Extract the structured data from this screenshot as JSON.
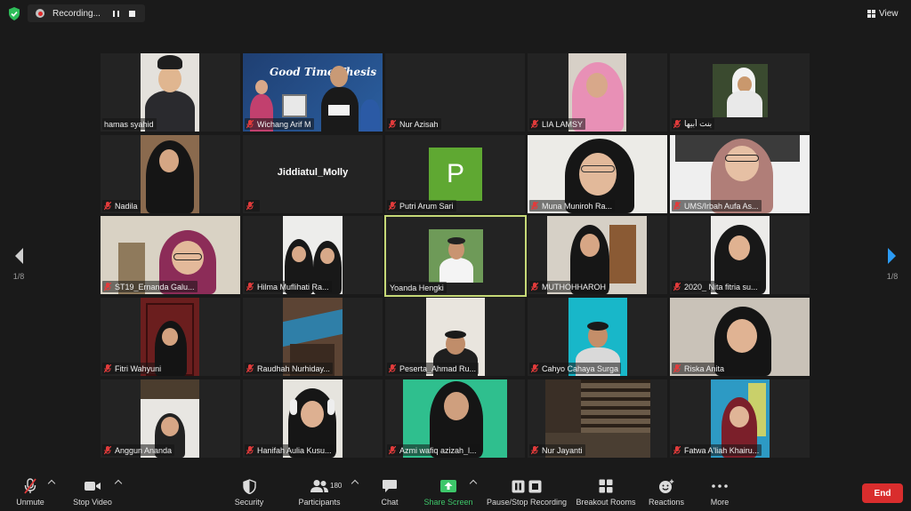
{
  "recording": {
    "label": "Recording..."
  },
  "view": {
    "label": "View"
  },
  "pager": {
    "left_label": "1/8",
    "right_label": "1/8"
  },
  "colors": {
    "active_speaker_border": "#c6d977",
    "end_button": "#d92d2d",
    "share_green": "#3dc76a",
    "avatar_green": "#5fa832"
  },
  "participants": [
    {
      "name": "hamas syahid",
      "muted": false
    },
    {
      "name": "Wichang Arif M",
      "muted": true
    },
    {
      "name": "Nur Azisah",
      "muted": true
    },
    {
      "name": "LIA LAMSY",
      "muted": true
    },
    {
      "name": "بنت أبيها",
      "muted": true
    },
    {
      "name": "Nadila",
      "muted": true
    },
    {
      "name": "Jiddiatul_Molly",
      "muted": true,
      "camera_off": true
    },
    {
      "name": "Putri Arum Sari",
      "muted": true,
      "avatar_letter": "P"
    },
    {
      "name": "Muna Muniroh Ra...",
      "muted": true
    },
    {
      "name": "UMS/Irbah Aufa As...",
      "muted": true
    },
    {
      "name": "ST19_Ernanda Galu...",
      "muted": true
    },
    {
      "name": "Hilma Muflihati Ra...",
      "muted": true
    },
    {
      "name": "Yoanda Hengki",
      "muted": false,
      "active": true
    },
    {
      "name": "MUTHOHHAROH",
      "muted": true
    },
    {
      "name": "2020_ Nita fitria su...",
      "muted": true
    },
    {
      "name": "Fitri Wahyuni",
      "muted": true
    },
    {
      "name": "Raudhah Nurhiday...",
      "muted": true
    },
    {
      "name": "Peserta_Ahmad Ru...",
      "muted": true
    },
    {
      "name": "Cahyo Cahaya Surga",
      "muted": true
    },
    {
      "name": "Riska Anita",
      "muted": true
    },
    {
      "name": "Anggun Ananda",
      "muted": true
    },
    {
      "name": "Hanifah Aulia Kusu...",
      "muted": true
    },
    {
      "name": "Azmi wafiq azizah_l...",
      "muted": true
    },
    {
      "name": "Nur Jayanti",
      "muted": true
    },
    {
      "name": "Fatwa A'liah Khairu...",
      "muted": true
    }
  ],
  "thumbnail_text": {
    "banner_title": "Good Time Thesis"
  },
  "toolbar": {
    "unmute": "Unmute",
    "stop_video": "Stop Video",
    "security": "Security",
    "participants": "Participants",
    "participants_count": "180",
    "chat": "Chat",
    "share_screen": "Share Screen",
    "pause_stop_recording": "Pause/Stop Recording",
    "breakout_rooms": "Breakout Rooms",
    "reactions": "Reactions",
    "more": "More",
    "end": "End"
  }
}
